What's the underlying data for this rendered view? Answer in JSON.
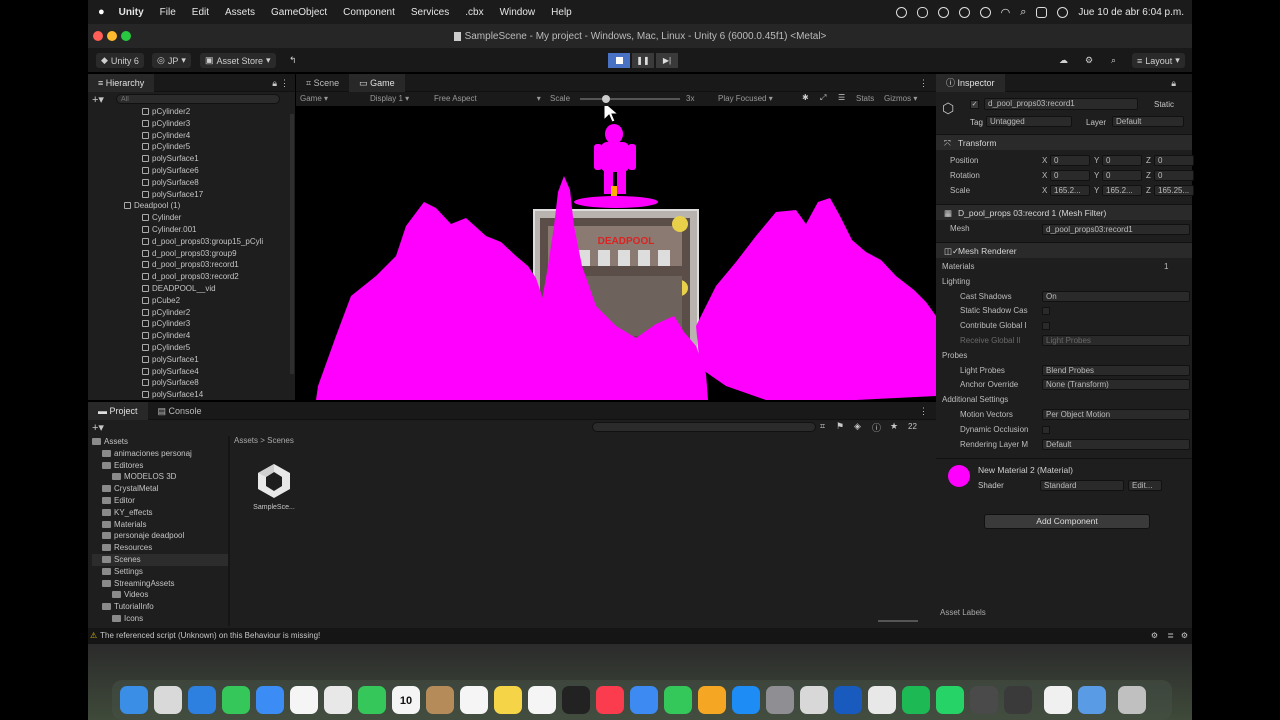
{
  "menubar": {
    "items": [
      "Unity",
      "File",
      "Edit",
      "Assets",
      "GameObject",
      "Component",
      "Services",
      ".cbx",
      "Window",
      "Help"
    ],
    "datetime": "Jue 10 de abr  6:04 p.m."
  },
  "window": {
    "title": "SampleScene - My project - Windows, Mac, Linux - Unity 6 (6000.0.45f1) <Metal>"
  },
  "toolbar": {
    "account": "Unity 6",
    "user": "JP",
    "asset_store": "Asset Store",
    "layout": "Layout"
  },
  "hierarchy": {
    "tab": "Hierarchy",
    "search_placeholder": "All",
    "items": [
      {
        "label": "pCylinder2",
        "indent": 3
      },
      {
        "label": "pCylinder3",
        "indent": 3
      },
      {
        "label": "pCylinder4",
        "indent": 3
      },
      {
        "label": "pCylinder5",
        "indent": 3
      },
      {
        "label": "polySurface1",
        "indent": 3
      },
      {
        "label": "polySurface6",
        "indent": 3
      },
      {
        "label": "polySurface8",
        "indent": 3
      },
      {
        "label": "polySurface17",
        "indent": 3
      },
      {
        "label": "Deadpool (1)",
        "indent": 2
      },
      {
        "label": "Cylinder",
        "indent": 3
      },
      {
        "label": "Cylinder.001",
        "indent": 3
      },
      {
        "label": "d_pool_props03:group15_pCyli",
        "indent": 3
      },
      {
        "label": "d_pool_props03:group9",
        "indent": 3
      },
      {
        "label": "d_pool_props03:record1",
        "indent": 3
      },
      {
        "label": "d_pool_props03:record2",
        "indent": 3
      },
      {
        "label": "DEADPOOL__vid",
        "indent": 3
      },
      {
        "label": "pCube2",
        "indent": 3
      },
      {
        "label": "pCylinder2",
        "indent": 3
      },
      {
        "label": "pCylinder3",
        "indent": 3
      },
      {
        "label": "pCylinder4",
        "indent": 3
      },
      {
        "label": "pCylinder5",
        "indent": 3
      },
      {
        "label": "polySurface1",
        "indent": 3
      },
      {
        "label": "polySurface4",
        "indent": 3
      },
      {
        "label": "polySurface8",
        "indent": 3
      },
      {
        "label": "polySurface14",
        "indent": 3
      }
    ]
  },
  "center": {
    "tabs": [
      "Scene",
      "Game"
    ],
    "game_bar": {
      "display_mode": "Game",
      "display": "Display 1",
      "aspect": "Free Aspect",
      "scale_label": "Scale",
      "scale_value": "3x",
      "play_focused": "Play Focused",
      "stats": "Stats",
      "gizmos": "Gizmos"
    },
    "poster_text": "DEADPOOL"
  },
  "project": {
    "tabs": [
      "Project",
      "Console"
    ],
    "breadcrumb": [
      "Assets",
      "Scenes"
    ],
    "tree": [
      {
        "label": "Assets",
        "indent": 0
      },
      {
        "label": "animaciones personaj",
        "indent": 1
      },
      {
        "label": "Editores",
        "indent": 1
      },
      {
        "label": "MODELOS 3D",
        "indent": 2
      },
      {
        "label": "CrystalMetal",
        "indent": 1
      },
      {
        "label": "Editor",
        "indent": 1
      },
      {
        "label": "KY_effects",
        "indent": 1
      },
      {
        "label": "Materials",
        "indent": 1
      },
      {
        "label": "personaje deadpool",
        "indent": 1
      },
      {
        "label": "Resources",
        "indent": 1
      },
      {
        "label": "Scenes",
        "indent": 1
      },
      {
        "label": "Settings",
        "indent": 1
      },
      {
        "label": "StreamingAssets",
        "indent": 1
      },
      {
        "label": "Videos",
        "indent": 2
      },
      {
        "label": "TutorialInfo",
        "indent": 1
      },
      {
        "label": "Icons",
        "indent": 2
      }
    ],
    "asset_label": "SampleSce...",
    "count": "22"
  },
  "inspector": {
    "tab": "Inspector",
    "object_name": "d_pool_props03:record1",
    "static_label": "Static",
    "tag_label": "Tag",
    "tag_value": "Untagged",
    "layer_label": "Layer",
    "layer_value": "Default",
    "transform": {
      "title": "Transform",
      "position_label": "Position",
      "rotation_label": "Rotation",
      "scale_label": "Scale",
      "position": [
        "0",
        "0",
        "0"
      ],
      "rotation": [
        "0",
        "0",
        "0"
      ],
      "scale": [
        "165.2...",
        "165.2...",
        "165.25..."
      ]
    },
    "mesh_filter": {
      "title": "D_pool_props 03:record 1 (Mesh Filter)",
      "mesh_label": "Mesh",
      "mesh_value": "d_pool_props03:record1"
    },
    "mesh_renderer": {
      "title": "Mesh Renderer",
      "materials_label": "Materials",
      "materials_count": "1",
      "lighting_label": "Lighting",
      "cast_shadows_label": "Cast Shadows",
      "cast_shadows_value": "On",
      "static_shadow_label": "Static Shadow Cas",
      "contribute_gi_label": "Contribute Global I",
      "receive_gi_label": "Receive Global Il",
      "receive_gi_value": "Light Probes",
      "probes_label": "Probes",
      "light_probes_label": "Light Probes",
      "light_probes_value": "Blend Probes",
      "anchor_label": "Anchor Override",
      "anchor_value": "None (Transform)",
      "additional_label": "Additional Settings",
      "motion_label": "Motion Vectors",
      "motion_value": "Per Object Motion",
      "dynamic_label": "Dynamic Occlusion",
      "rendering_layer_label": "Rendering Layer M",
      "rendering_layer_value": "Default"
    },
    "material": {
      "title": "New Material 2 (Material)",
      "shader_label": "Shader",
      "shader_value": "Standard",
      "edit_label": "Edit..."
    },
    "add_component": "Add Component",
    "asset_labels": "Asset Labels"
  },
  "status_bar": {
    "warning": "The referenced script (Unknown) on this Behaviour is missing!"
  },
  "colors": {
    "magenta": "#ff00ff",
    "panel": "#1e1e1e",
    "accent": "#3a5ea8"
  },
  "dock": {
    "icons": [
      "finder-icon",
      "launchpad-icon",
      "safari-icon",
      "messages-icon",
      "mail-icon",
      "photos-icon",
      "chrome-icon",
      "facetime-icon",
      "calendar-icon",
      "contacts-icon",
      "reminders-icon",
      "notes-icon",
      "freeform-icon",
      "tv-icon",
      "music-icon",
      "keynote-icon",
      "numbers-icon",
      "pages-icon",
      "appstore-icon",
      "system-settings-icon",
      "iphone-mirroring-icon",
      "word-icon",
      "chrome2-icon",
      "spotify-icon",
      "whatsapp-icon",
      "unity-hub-icon",
      "unity-icon",
      "preview-icon",
      "downloads-icon",
      "trash-icon"
    ],
    "calendar_day": "10"
  }
}
